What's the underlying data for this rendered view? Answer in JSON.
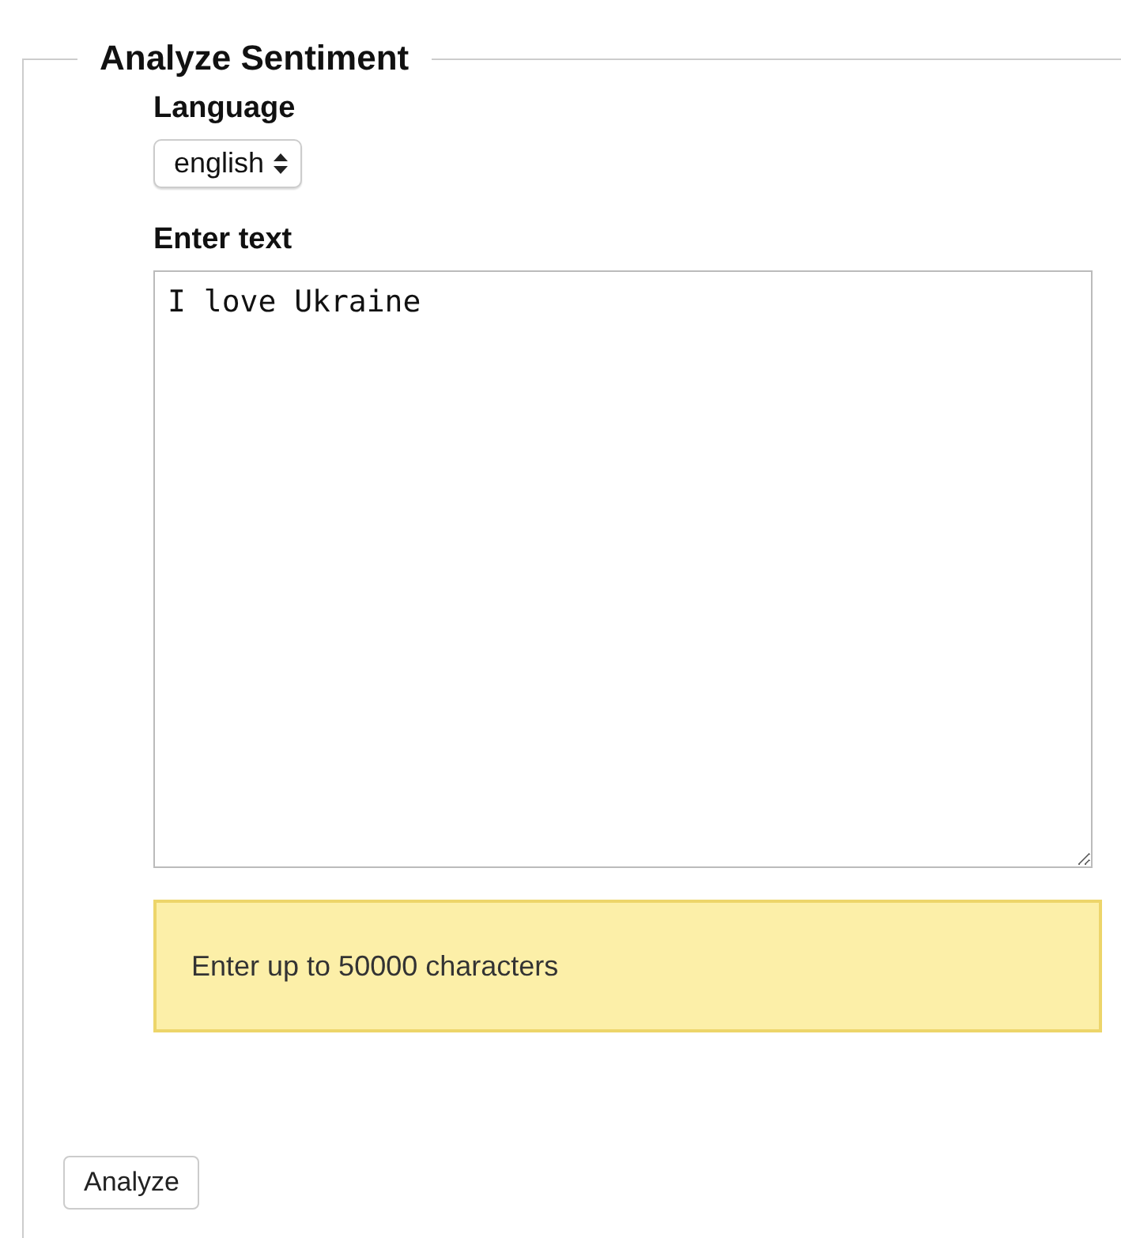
{
  "form": {
    "legend": "Analyze Sentiment",
    "language": {
      "label": "Language",
      "value": "english"
    },
    "text": {
      "label": "Enter text",
      "value": "I love Ukraine"
    },
    "notice": "Enter up to 50000 characters",
    "button": "Analyze"
  }
}
